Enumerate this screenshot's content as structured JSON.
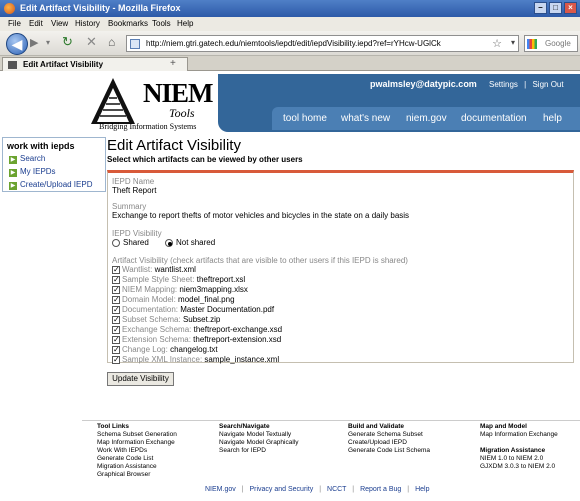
{
  "window": {
    "title": "Edit Artifact Visibility - Mozilla Firefox"
  },
  "menu": [
    "File",
    "Edit",
    "View",
    "History",
    "Bookmarks",
    "Tools",
    "Help"
  ],
  "address": {
    "url": "http://niem.gtri.gatech.edu/niemtools/iepdt/edit/iepdVisibility.iepd?ref=rYHcw-UGlCk",
    "search_placeholder": "Google"
  },
  "tab": {
    "label": "Edit Artifact Visibility"
  },
  "header": {
    "logo_big": "NIEM",
    "logo_small": "Tools",
    "logo_tag": "Bridging Information Systems",
    "email": "pwalmsley@datypic.com",
    "settings": "Settings",
    "signout": "Sign Out",
    "nav": [
      "tool home",
      "what's new",
      "niem.gov",
      "documentation",
      "help"
    ]
  },
  "sidebar": {
    "heading": "work with iepds",
    "items": [
      "Search",
      "My IEPDs",
      "Create/Upload IEPD"
    ]
  },
  "page": {
    "title": "Edit Artifact Visibility",
    "subtitle": "Select which artifacts can be viewed by other users"
  },
  "form": {
    "name_label": "IEPD Name",
    "name_value": "Theft Report",
    "summary_label": "Summary",
    "summary_value": "Exchange to report thefts of motor vehicles and bicycles in the state on a daily basis",
    "visibility_label": "IEPD Visibility",
    "shared": "Shared",
    "not_shared": "Not shared",
    "artifact_heading": "Artifact Visibility (check artifacts that are visible to other users if this IEPD is shared)",
    "artifacts": [
      {
        "label": "Wantlist:",
        "value": "wantlist.xml"
      },
      {
        "label": "Sample Style Sheet:",
        "value": "theftreport.xsl"
      },
      {
        "label": "NIEM Mapping:",
        "value": "niem3mapping.xlsx"
      },
      {
        "label": "Domain Model:",
        "value": "model_final.png"
      },
      {
        "label": "Documentation:",
        "value": "Master Documentation.pdf"
      },
      {
        "label": "Subset Schema:",
        "value": "Subset.zip"
      },
      {
        "label": "Exchange Schema:",
        "value": "theftreport-exchange.xsd"
      },
      {
        "label": "Extension Schema:",
        "value": "theftreport-extension.xsd"
      },
      {
        "label": "Change Log:",
        "value": "changelog.txt"
      },
      {
        "label": "Sample XML Instance:",
        "value": "sample_instance.xml"
      }
    ],
    "update_button": "Update Visibility"
  },
  "footer": {
    "col1": {
      "heading": "Tool Links",
      "items": [
        "Schema Subset Generation",
        "Map Information Exchange",
        "Work With IEPDs",
        "Generate Code List",
        "Migration Assistance",
        "Graphical Browser"
      ]
    },
    "col2": {
      "heading": "Search/Navigate",
      "items": [
        "Navigate Model Textually",
        "Navigate Model Graphically",
        "Search for IEPD"
      ]
    },
    "col3": {
      "heading": "Build and Validate",
      "items": [
        "Generate Schema Subset",
        "Create/Upload IEPD",
        "Generate Code List Schema"
      ]
    },
    "col4": {
      "heading": "Map and Model",
      "items": [
        "Map Information Exchange"
      ]
    },
    "col5": {
      "heading": "Migration Assistance",
      "items": [
        "NIEM 1.0 to NIEM 2.0",
        "GJXDM 3.0.3 to NIEM 2.0"
      ]
    },
    "bottom": [
      "NIEM.gov",
      "Privacy and Security",
      "NCCT",
      "Report a Bug",
      "Help"
    ]
  }
}
